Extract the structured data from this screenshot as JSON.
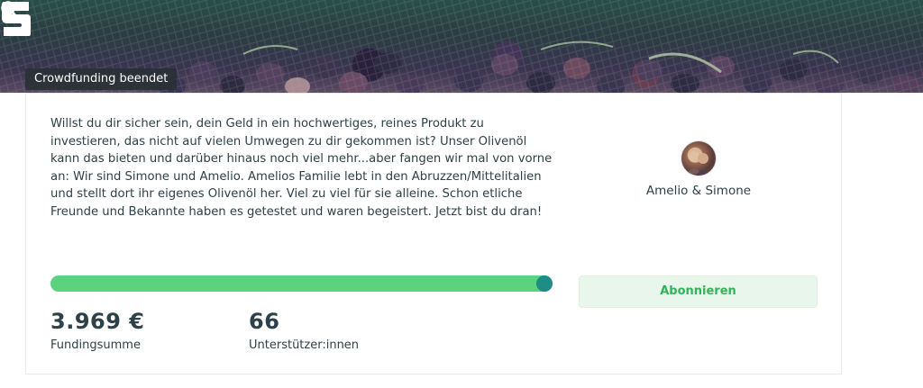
{
  "header": {
    "logo_icon": "startnext-logo-icon",
    "search_icon": "search-icon"
  },
  "campaign": {
    "status_badge": "Crowdfunding beendet",
    "description": "Willst du dir sicher sein, dein Geld in ein hochwertiges, reines Produkt zu investieren, das nicht auf vielen Umwegen zu dir gekommen ist? Unser Olivenöl kann das bieten und darüber hinaus noch viel mehr...aber fangen wir mal von vorne an: Wir sind Simone und Amelio. Amelios Familie lebt in den Abruzzen/Mittelitalien und stellt dort ihr eigenes Olivenöl her. Viel zu viel für sie alleine. Schon etliche Freunde und Bekannte haben es getestet und waren begeistert. Jetzt bist du dran!",
    "author_name": "Amelio & Simone",
    "progress_fraction": 1.0,
    "subscribe_label": "Abonnieren",
    "funding_amount": "3.969 €",
    "funding_label": "Fundingsumme",
    "supporters_count": "66",
    "supporters_label": "Unterstützer:innen"
  },
  "colors": {
    "accent_green": "#5dd27e",
    "knob_teal": "#1f8d86",
    "button_text_green": "#33b35b"
  }
}
